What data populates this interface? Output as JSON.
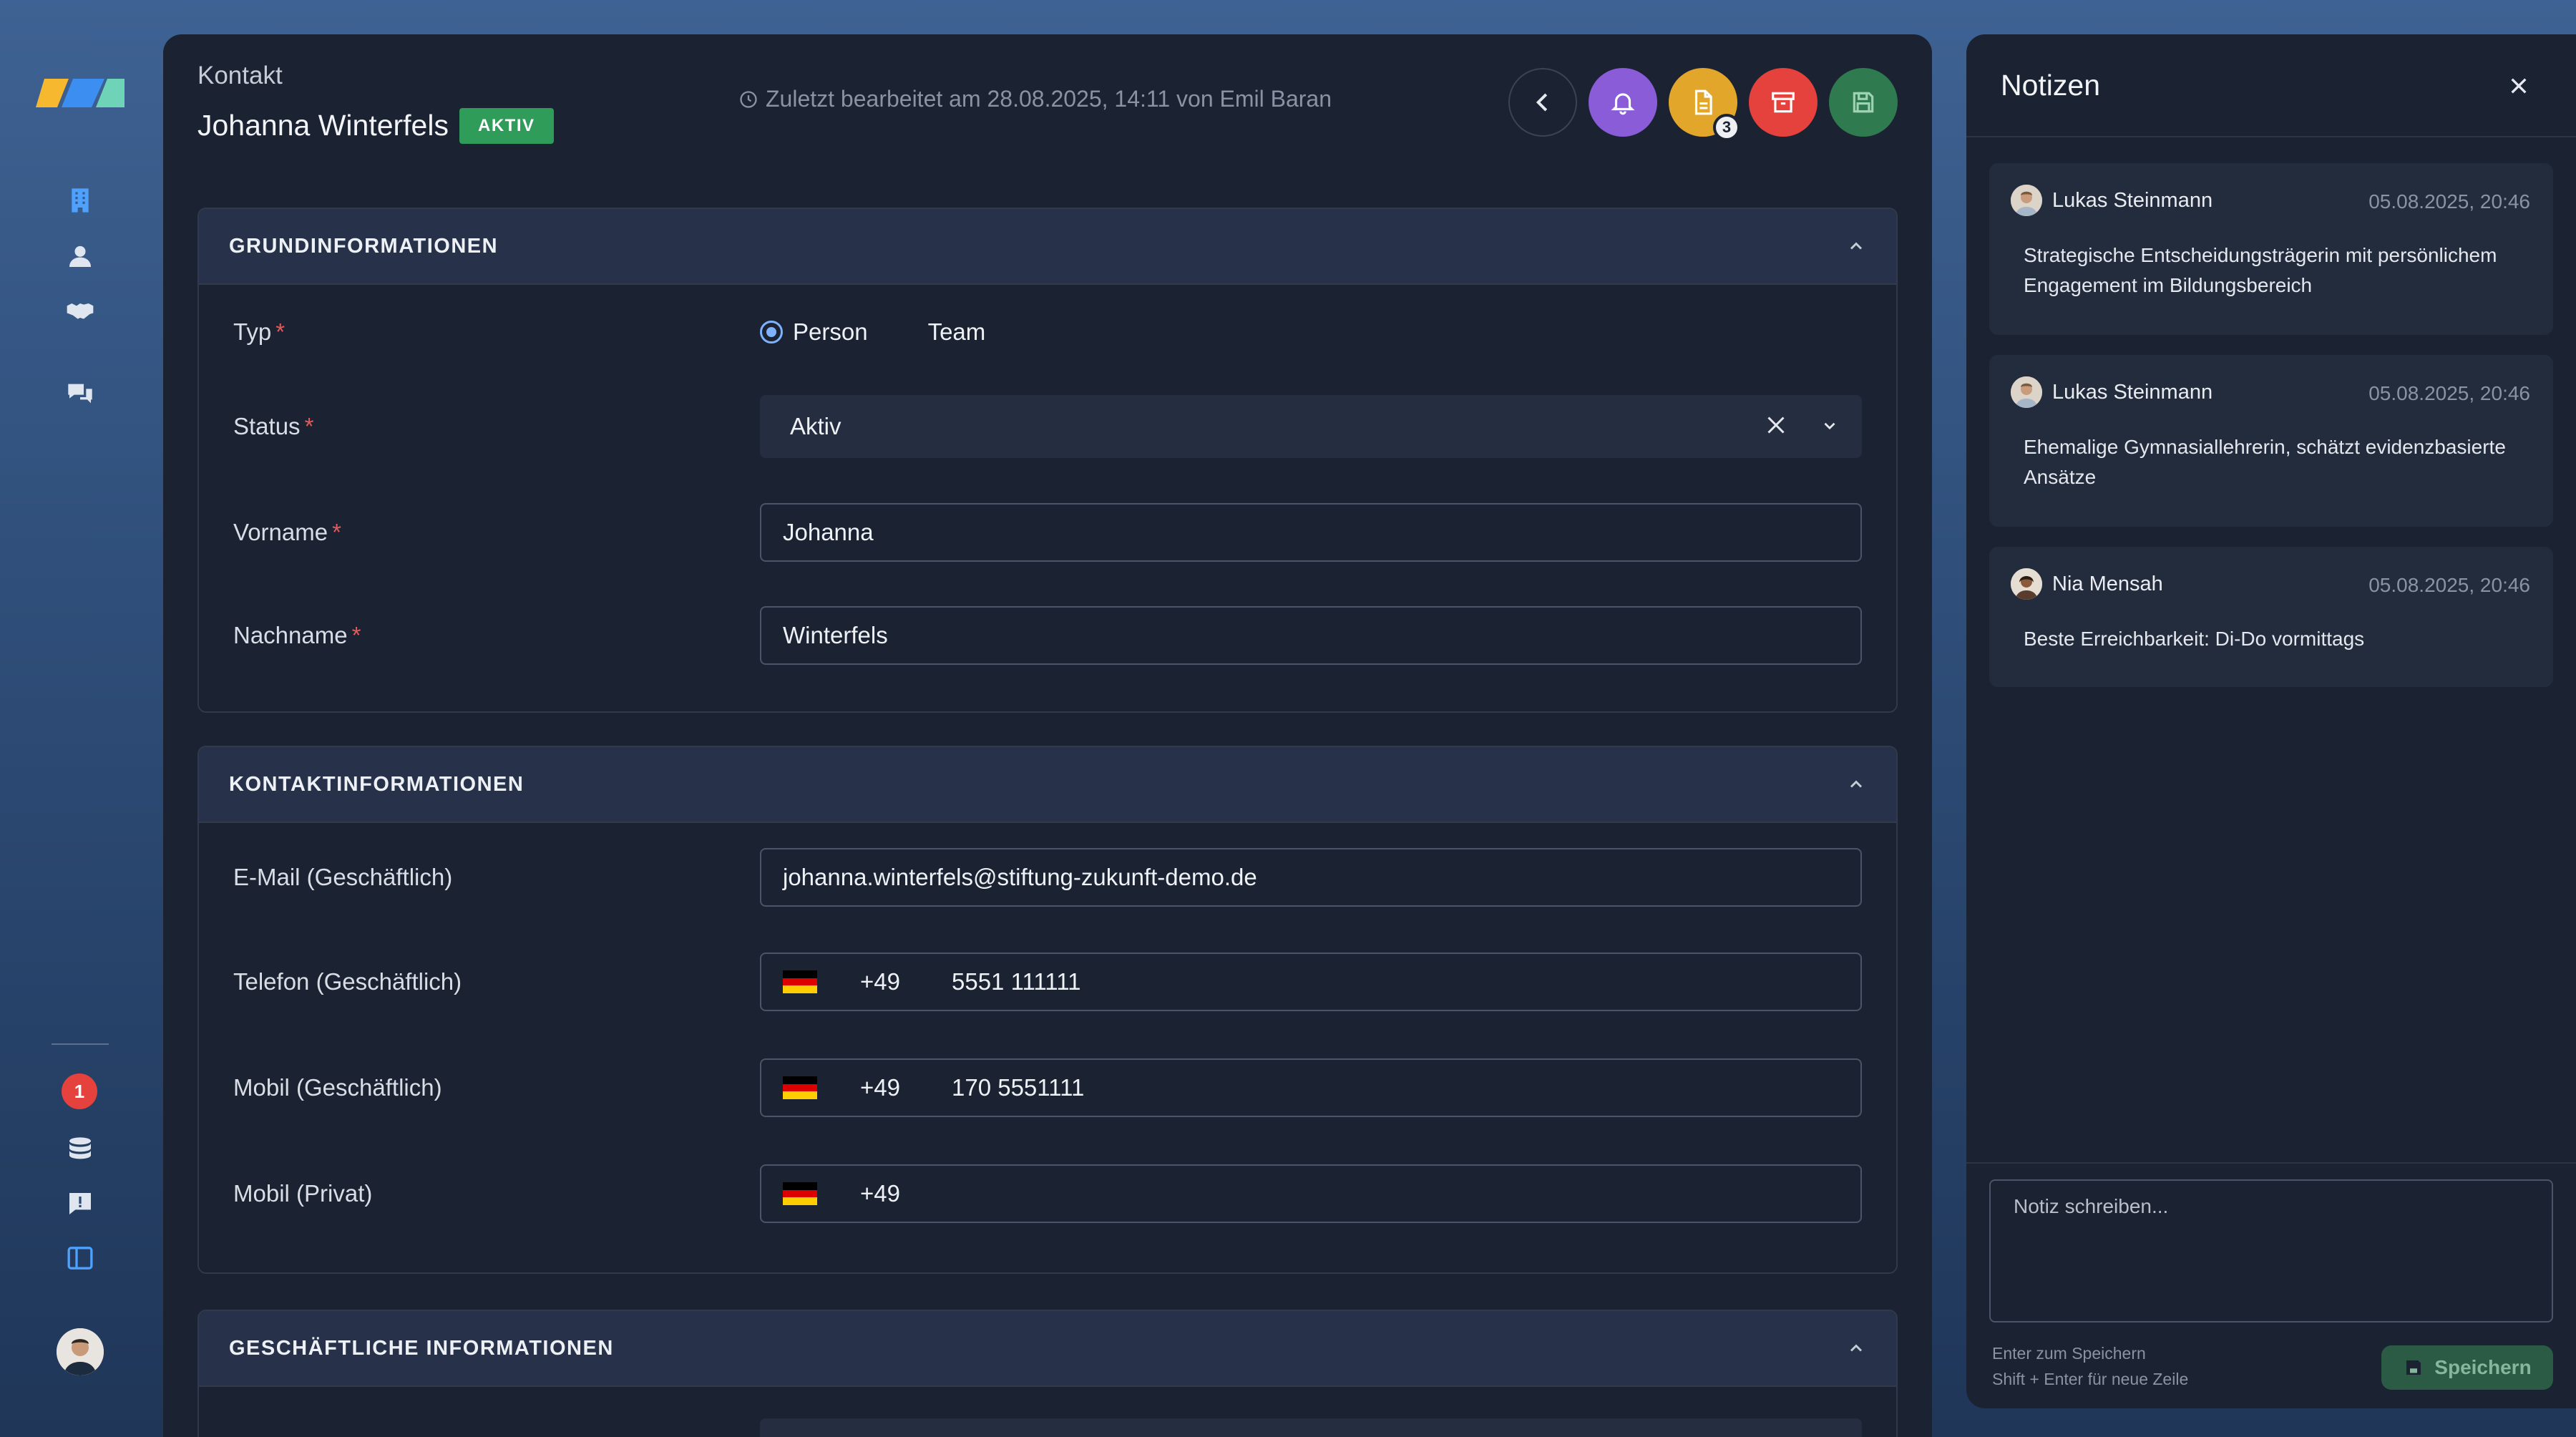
{
  "rail": {
    "notification_count": "1"
  },
  "header": {
    "breadcrumb": "Kontakt",
    "name": "Johanna Winterfels",
    "status_badge": "AKTIV",
    "last_edited": "Zuletzt bearbeitet am 28.08.2025, 14:11 von Emil Baran",
    "documents_count": "3"
  },
  "sections": {
    "basic": {
      "title": "GRUNDINFORMATIONEN",
      "type_label": "Typ",
      "type_options": [
        "Person",
        "Team"
      ],
      "status_label": "Status",
      "status_value": "Aktiv",
      "firstname_label": "Vorname",
      "firstname_value": "Johanna",
      "lastname_label": "Nachname",
      "lastname_value": "Winterfels"
    },
    "contact": {
      "title": "KONTAKTINFORMATIONEN",
      "email_label": "E-Mail (Geschäftlich)",
      "email_value": "johanna.winterfels@stiftung-zukunft-demo.de",
      "phone_label": "Telefon (Geschäftlich)",
      "phone_cc": "+49",
      "phone_value": "5551 111111",
      "mobile_label": "Mobil (Geschäftlich)",
      "mobile_cc": "+49",
      "mobile_value": "170 5551111",
      "mobile_private_label": "Mobil (Privat)",
      "mobile_private_cc": "+49",
      "mobile_private_value": ""
    },
    "business": {
      "title": "GESCHÄFTLICHE INFORMATIONEN"
    }
  },
  "notes": {
    "title": "Notizen",
    "items": [
      {
        "author": "Lukas Steinmann",
        "time": "05.08.2025, 20:46",
        "text": "Strategische Entscheidungsträgerin mit persönlichem Engagement im Bildungsbereich"
      },
      {
        "author": "Lukas Steinmann",
        "time": "05.08.2025, 20:46",
        "text": "Ehemalige Gymnasiallehrerin, schätzt evidenzbasierte Ansätze"
      },
      {
        "author": "Nia Mensah",
        "time": "05.08.2025, 20:46",
        "text": "Beste Erreichbarkeit: Di-Do vormittags"
      }
    ],
    "composer_placeholder": "Notiz schreiben...",
    "hint_enter": "Enter zum Speichern",
    "hint_shift": "Shift + Enter für neue Zeile",
    "save_label": "Speichern"
  },
  "colors": {
    "accent_purple": "#8a5cd8",
    "accent_yellow": "#e2a72a",
    "accent_red": "#e5413d",
    "accent_green": "#2f7a4f",
    "badge_green": "#2f9c59"
  },
  "icons": [
    "logo",
    "building-icon",
    "person-icon",
    "handshake-icon",
    "chat-icon",
    "database-icon",
    "feedback-icon",
    "sidebar-toggle-icon",
    "back-icon",
    "bell-icon",
    "document-icon",
    "archive-icon",
    "save-icon",
    "clock-icon",
    "close-icon",
    "chevron-up-icon",
    "chevron-down-icon"
  ]
}
